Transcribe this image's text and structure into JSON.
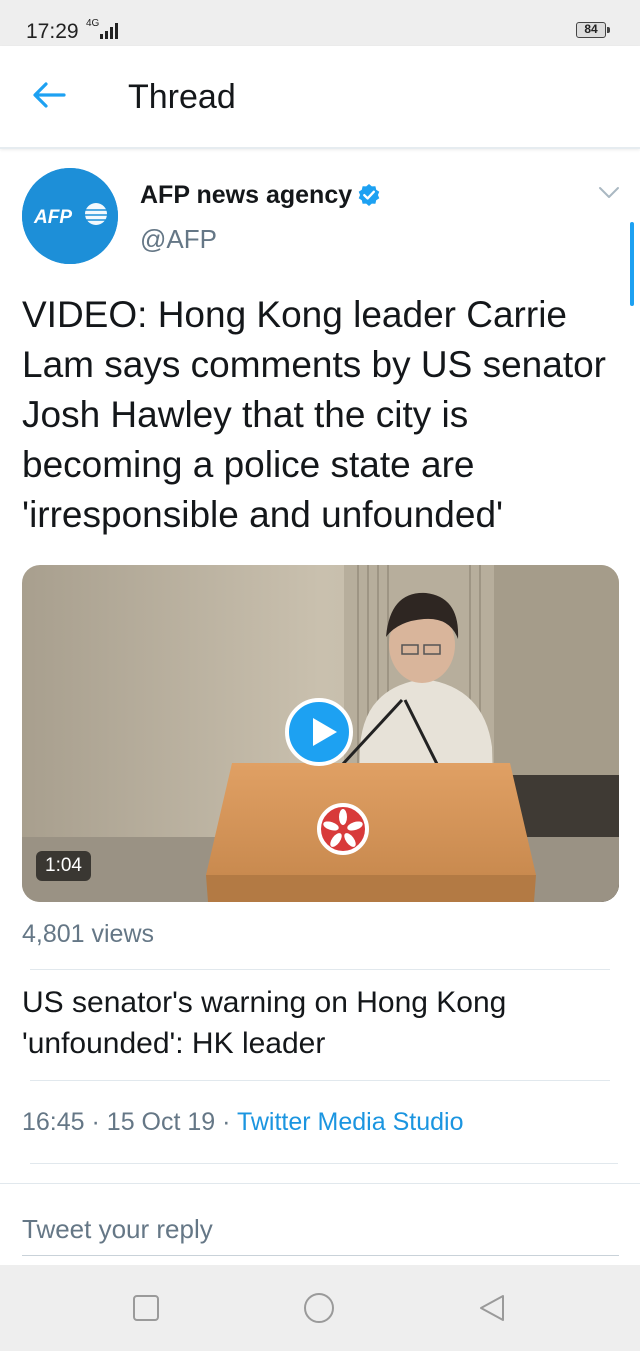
{
  "status_bar": {
    "time": "17:29",
    "network": "4G",
    "battery": "84"
  },
  "header": {
    "title": "Thread",
    "back_icon": "arrow-left-icon"
  },
  "tweet": {
    "avatar_logo_text": "AFP",
    "author_name": "AFP news agency",
    "handle": "@AFP",
    "verified": true,
    "text": "VIDEO: Hong Kong leader Carrie Lam says comments by US senator Josh Hawley that the city is becoming a police state are 'irresponsible and unfounded'",
    "media": {
      "type": "video",
      "duration": "1:04"
    },
    "views": "4,801 views",
    "card_title": "US senator's warning on Hong Kong 'unfounded': HK leader",
    "time": "16:45",
    "date": "15 Oct 19",
    "separator": "·",
    "source": "Twitter Media Studio"
  },
  "reply": {
    "placeholder": "Tweet your reply"
  },
  "colors": {
    "accent": "#1da1f2",
    "link": "#1b95e0",
    "secondary_text": "#657786",
    "avatar_bg": "#1d8fd8"
  },
  "nav": {
    "recent_icon": "square-icon",
    "home_icon": "circle-icon",
    "back_icon": "triangle-back-icon"
  }
}
